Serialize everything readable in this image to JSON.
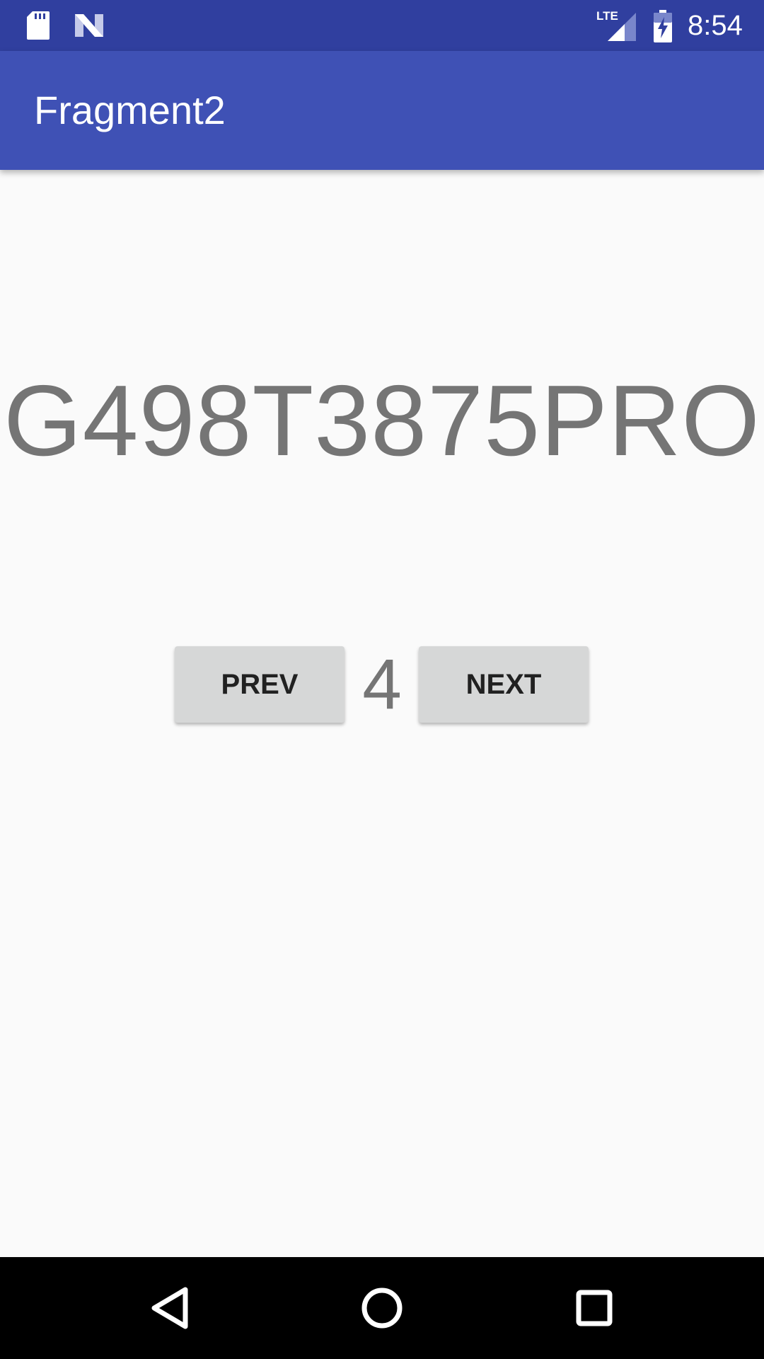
{
  "status_bar": {
    "time": "8:54",
    "network": "LTE",
    "icons": [
      "sd-card-icon",
      "n-logo-icon",
      "lte-signal-icon",
      "battery-charging-icon"
    ]
  },
  "app_bar": {
    "title": "Fragment2",
    "color": "#3f51b5"
  },
  "main": {
    "code": "G498T3875PRO",
    "page_number": "4",
    "prev_label": "PREV",
    "next_label": "NEXT"
  },
  "nav_bar": {
    "icons": [
      "back-icon",
      "home-icon",
      "recents-icon"
    ]
  }
}
